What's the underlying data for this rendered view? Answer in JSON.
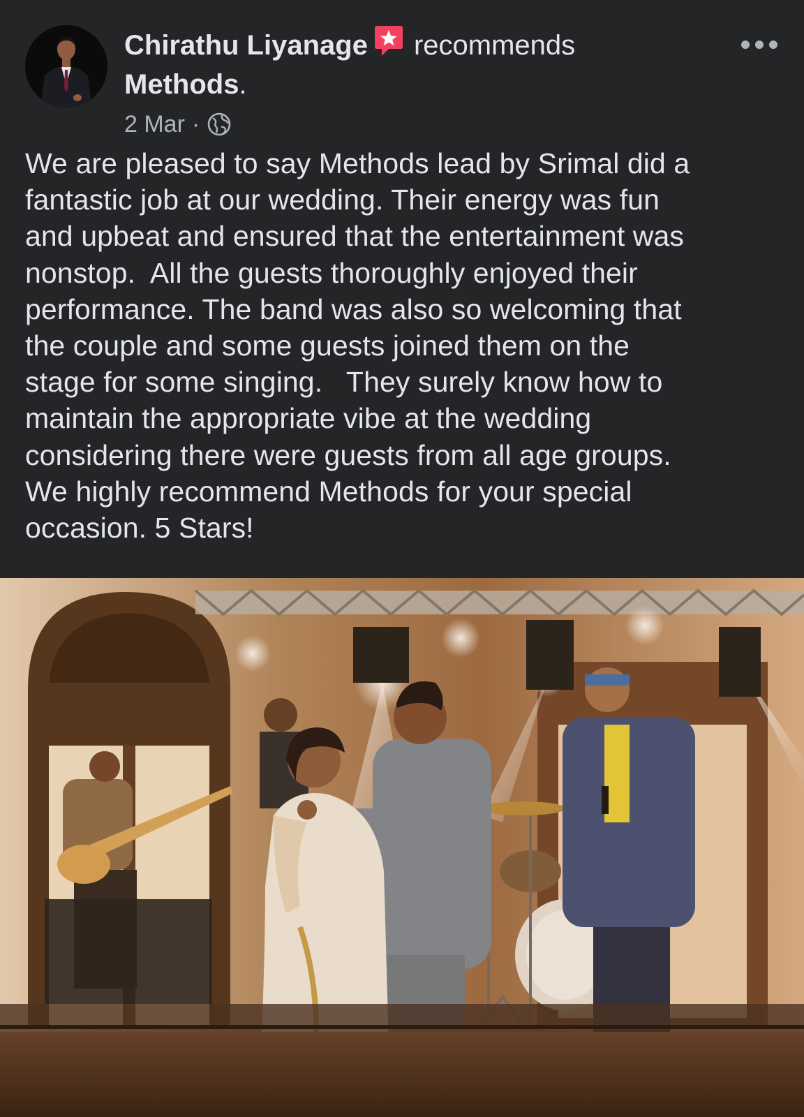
{
  "post": {
    "author": "Chirathu Liyanage",
    "recommends_text": "recommends",
    "page_name": "Methods",
    "page_name_suffix": ".",
    "date": "2 Mar",
    "separator": "·",
    "audience_icon": "globe-icon",
    "recommend_badge_icon": "star-recommend-icon",
    "more_icon": "more-options-icon",
    "text": "We are pleased to say Methods lead by Srimal did a\nfantastic job at our wedding. Their energy was fun\nand upbeat and ensured that the entertainment was\nnonstop.  All the guests thoroughly enjoyed their\nperformance. The band was also so welcoming that\nthe couple and some guests joined them on the\nstage for some singing.   They surely know how to\nmaintain the appropriate vibe at the wedding\nconsidering there were guests from all age groups.\nWe highly recommend Methods for your special\noccasion. 5 Stars!"
  },
  "colors": {
    "background": "#242526",
    "text_primary": "#e4e6eb",
    "text_secondary": "#b0b3b8",
    "recommend_badge": "#f3425f"
  }
}
